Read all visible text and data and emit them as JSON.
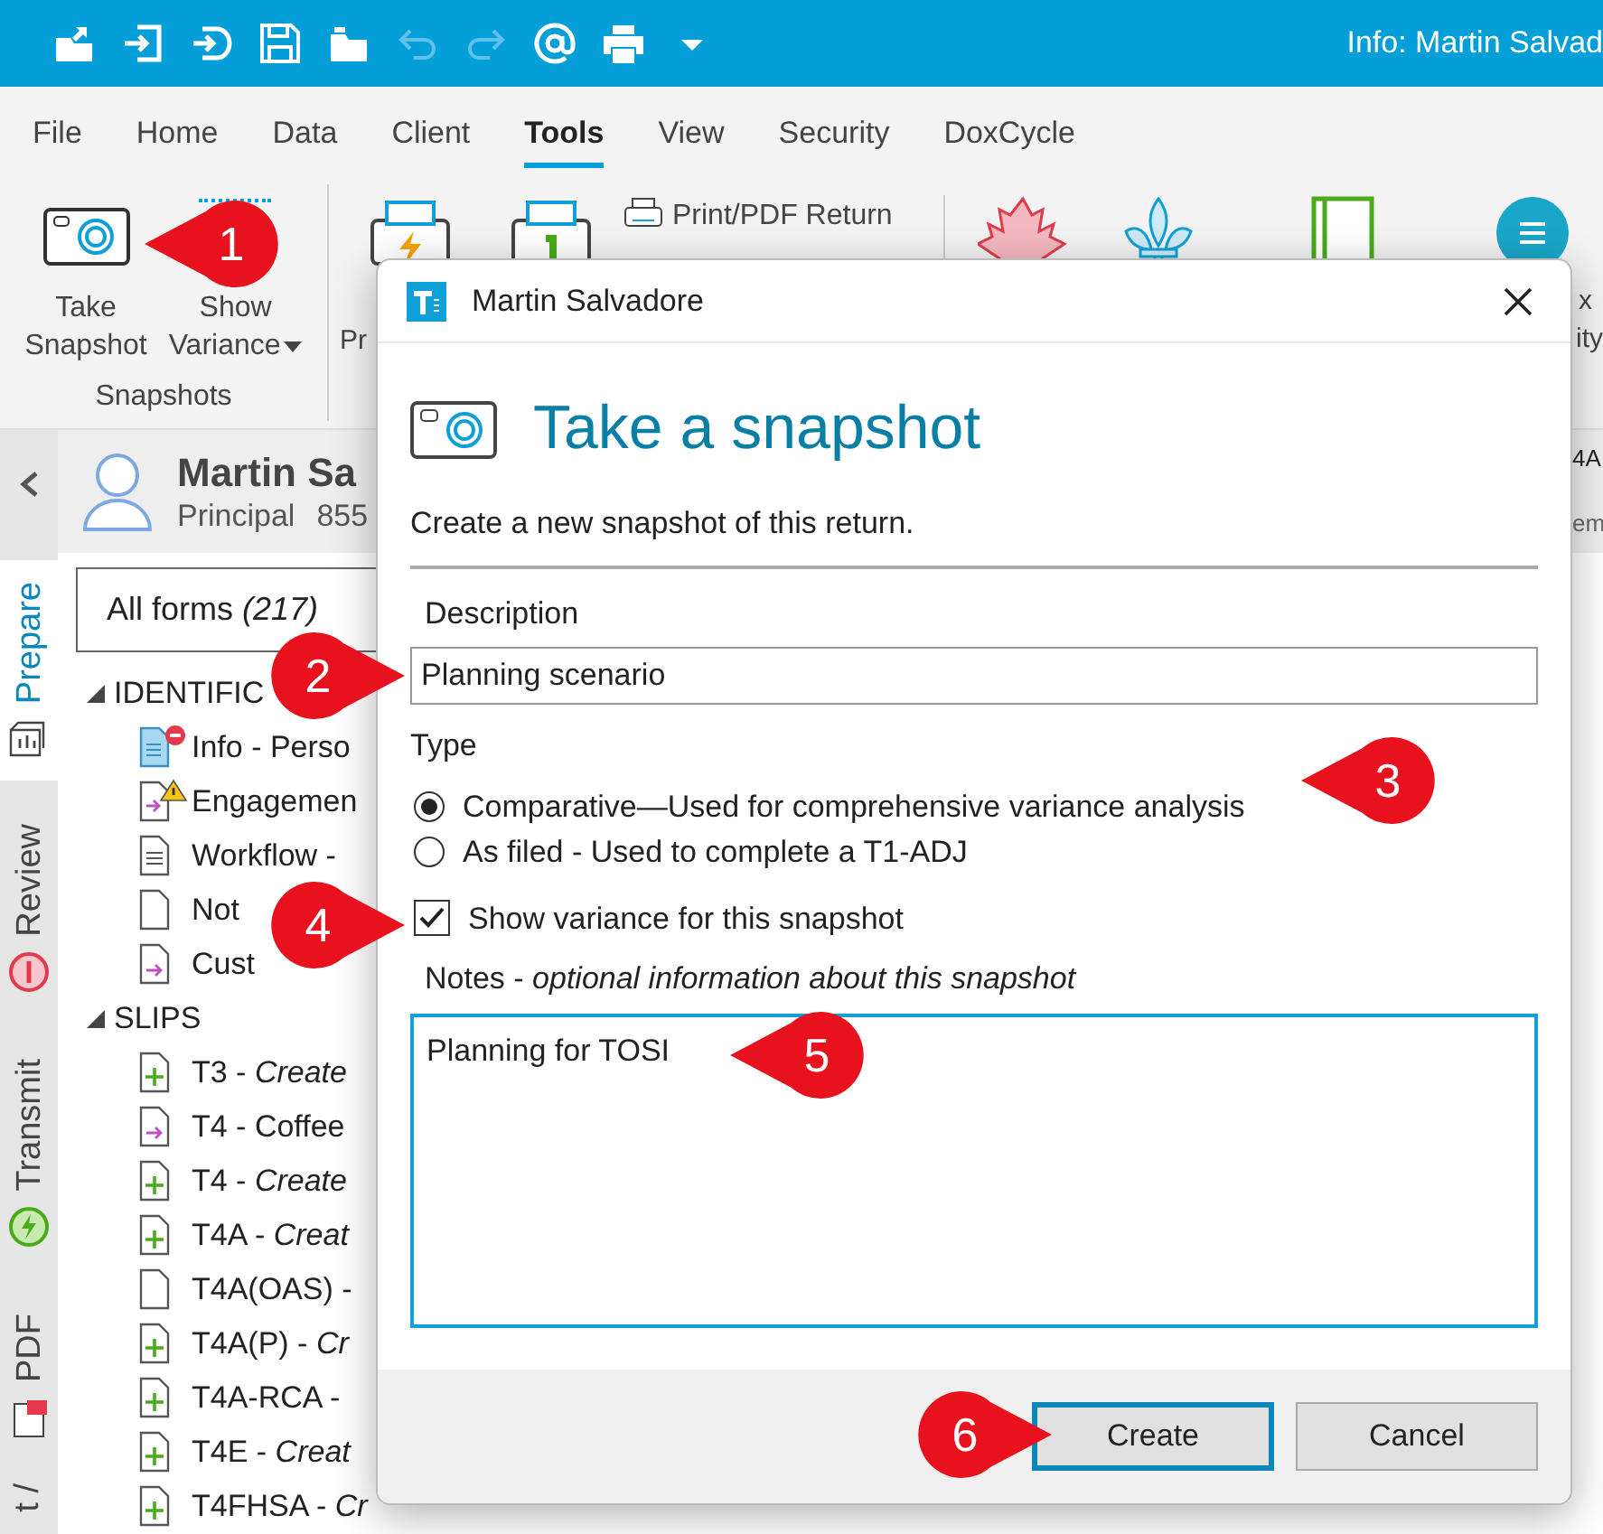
{
  "window": {
    "title": "Info: Martin Salvad"
  },
  "quick_access": [
    {
      "kind": "share",
      "disabled": false
    },
    {
      "kind": "import",
      "disabled": false
    },
    {
      "kind": "login",
      "disabled": false
    },
    {
      "kind": "save",
      "disabled": false
    },
    {
      "kind": "open",
      "disabled": false
    },
    {
      "kind": "undo",
      "disabled": true
    },
    {
      "kind": "redo",
      "disabled": true
    },
    {
      "kind": "email",
      "disabled": false
    },
    {
      "kind": "print",
      "disabled": false
    },
    {
      "kind": "dropdown",
      "disabled": false
    }
  ],
  "menu_tabs": [
    {
      "label": "File",
      "selected": false
    },
    {
      "label": "Home",
      "selected": false
    },
    {
      "label": "Data",
      "selected": false
    },
    {
      "label": "Client",
      "selected": false
    },
    {
      "label": "Tools",
      "selected": true
    },
    {
      "label": "View",
      "selected": false
    },
    {
      "label": "Security",
      "selected": false
    },
    {
      "label": "DoxCycle",
      "selected": false
    }
  ],
  "ribbon": {
    "snapshots_group": "Snapshots",
    "take_snapshot": [
      "Take",
      "Snapshot"
    ],
    "show_variance": [
      "Show",
      "Variance"
    ],
    "print_label": "Pr",
    "print_pdf_return": "Print/PDF Return",
    "cut_label_1": "x",
    "cut_label_2": "ity"
  },
  "side_tabs": [
    {
      "label": "Prepare",
      "selected": true,
      "kind": "prepare"
    },
    {
      "label": "Review",
      "selected": false,
      "kind": "review"
    },
    {
      "label": "Transmit",
      "selected": false,
      "kind": "transmit"
    },
    {
      "label": "PDF",
      "selected": false,
      "kind": "pdf"
    },
    {
      "label": "t /",
      "selected": false,
      "kind": "cut"
    }
  ],
  "client": {
    "name": "Martin Sa",
    "role": "Principal",
    "number": "855",
    "cut_1": "4A",
    "cut_2": "em"
  },
  "forms": {
    "filter": "All forms *(217)*",
    "groups": [
      {
        "label": "IDENTIFIC",
        "expanded": true,
        "children": [
          {
            "label": "Info - Perso",
            "kind": "info-error"
          },
          {
            "label": "Engagemen",
            "kind": "engagement-warning"
          },
          {
            "label": "Workflow -",
            "kind": "text"
          },
          {
            "label": "Not",
            "kind": "blank"
          },
          {
            "label": "Cust",
            "kind": "arrow"
          }
        ]
      },
      {
        "label": "SLIPS",
        "expanded": true,
        "children": [
          {
            "label": "T3 - *Create*",
            "kind": "plus"
          },
          {
            "label": "T4 - Coffee",
            "kind": "arrow"
          },
          {
            "label": "T4 - *Create*",
            "kind": "plus"
          },
          {
            "label": "T4A - *Creat*",
            "kind": "plus"
          },
          {
            "label": "T4A(OAS) -",
            "kind": "blank"
          },
          {
            "label": "T4A(P) - *Cr*",
            "kind": "plus"
          },
          {
            "label": "T4A-RCA -",
            "kind": "plus"
          },
          {
            "label": "T4E - *Creat*",
            "kind": "plus"
          },
          {
            "label": "T4FHSA - *Cr*",
            "kind": "plus"
          }
        ]
      }
    ]
  },
  "dialog": {
    "title": "Martin Salvadore",
    "heading": "Take a snapshot",
    "intro": "Create a new snapshot of this return.",
    "description_label": "Description",
    "description_value": "Planning scenario",
    "type_label": "Type",
    "types": [
      {
        "label": "Comparative—Used for comprehensive variance analysis",
        "selected": true
      },
      {
        "label": "As filed - Used to complete a T1-ADJ",
        "selected": false
      }
    ],
    "show_variance": {
      "label": "Show variance for this snapshot",
      "checked": true
    },
    "notes_label": "Notes - *optional information about this snapshot*",
    "notes_value": "Planning for TOSI",
    "buttons": [
      {
        "label": "Create",
        "kind": "primary"
      },
      {
        "label": "Cancel",
        "kind": "secondary"
      }
    ]
  },
  "callouts": [
    "1",
    "2",
    "3",
    "4",
    "5",
    "6"
  ]
}
